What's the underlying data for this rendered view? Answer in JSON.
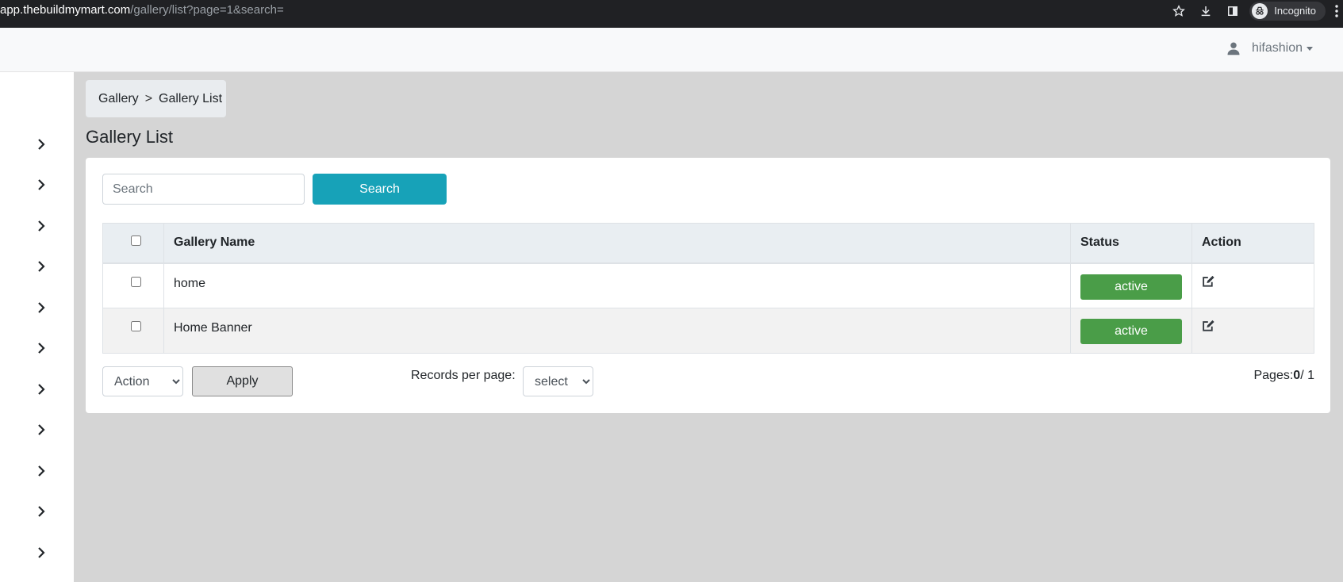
{
  "browser": {
    "url_host": "app.thebuildmymart.com",
    "url_path": "/gallery/list?page=1&search=",
    "incognito_label": "Incognito"
  },
  "topbar": {
    "username": "hifashion"
  },
  "sidebar": {
    "items": [
      {
        "icon": "chevron-right-icon"
      },
      {
        "icon": "chevron-right-icon"
      },
      {
        "icon": "chevron-right-icon"
      },
      {
        "icon": "chevron-right-icon"
      },
      {
        "icon": "chevron-right-icon"
      },
      {
        "icon": "chevron-right-icon"
      },
      {
        "icon": "chevron-right-icon"
      },
      {
        "icon": "chevron-right-icon"
      },
      {
        "icon": "chevron-right-icon"
      },
      {
        "icon": "chevron-right-icon"
      },
      {
        "icon": "chevron-right-icon"
      }
    ]
  },
  "breadcrumb": {
    "parent": "Gallery",
    "separator": ">",
    "current": "Gallery List"
  },
  "page": {
    "title": "Gallery List"
  },
  "search": {
    "placeholder": "Search",
    "value": "",
    "button_label": "Search"
  },
  "table": {
    "headers": {
      "name": "Gallery Name",
      "status": "Status",
      "action": "Action"
    },
    "rows": [
      {
        "name": "home",
        "status": "active"
      },
      {
        "name": "Home Banner",
        "status": "active"
      }
    ]
  },
  "footer": {
    "bulk_action_selected": "Action",
    "apply_label": "Apply",
    "records_per_page_label": "Records per page:",
    "records_per_page_selected": "select",
    "pages_label": "Pages:",
    "current_page": "0",
    "total_pages": "/ 1"
  },
  "colors": {
    "accent": "#17a2b8",
    "status_active": "#4a9d48"
  }
}
